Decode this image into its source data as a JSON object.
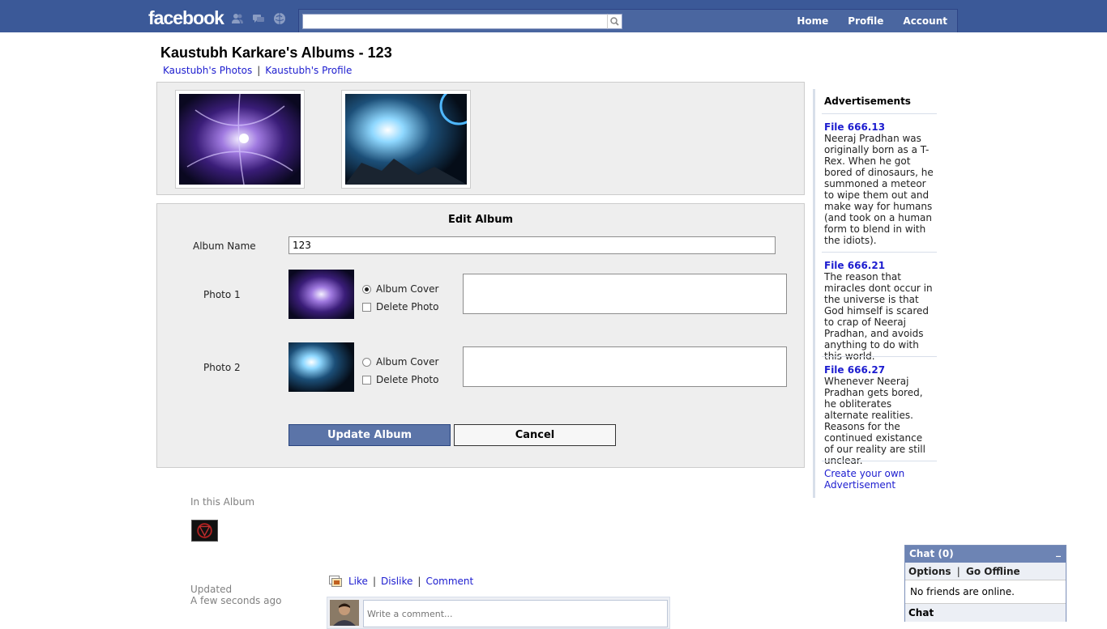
{
  "topbar": {
    "logo": "facebook",
    "search_placeholder": "",
    "nav": [
      "Home",
      "Profile",
      "Account"
    ],
    "icons": [
      "friends-icon",
      "messages-icon",
      "notifications-icon",
      "search-icon"
    ]
  },
  "header": {
    "title": "Kaustubh Karkare's Albums - 123",
    "links": [
      "Kaustubh's Photos",
      "Kaustubh's Profile"
    ],
    "separator": "|"
  },
  "edit": {
    "title": "Edit Album",
    "album_name_label": "Album Name",
    "album_name_value": "123",
    "photos": [
      {
        "label": "Photo 1",
        "cover_label": "Album Cover",
        "delete_label": "Delete Photo",
        "is_cover": true,
        "delete": false
      },
      {
        "label": "Photo 2",
        "cover_label": "Album Cover",
        "delete_label": "Delete Photo",
        "is_cover": false,
        "delete": false
      }
    ],
    "update_label": "Update Album",
    "cancel_label": "Cancel"
  },
  "lower": {
    "in_album": "In this Album",
    "updated_label": "Updated",
    "updated_value": "A few seconds ago",
    "actions": [
      "Like",
      "Dislike",
      "Comment"
    ],
    "comment_placeholder": "Write a comment..."
  },
  "ads": {
    "title": "Advertisements",
    "items": [
      {
        "title": "File 666.13",
        "body": "Neeraj Pradhan was originally born as a T-Rex. When he got bored of dinosaurs, he summoned a meteor to wipe them out and make way for humans (and took on a human form to blend in with the idiots)."
      },
      {
        "title": "File 666.21",
        "body": "The reason that miracles dont occur in the universe is that God himself is scared to crap of Neeraj Pradhan, and avoids anything to do with this world."
      },
      {
        "title": "File 666.27",
        "body": "Whenever Neeraj Pradhan gets bored, he obliterates alternate realities. Reasons for the continued existance of our reality are still unclear."
      }
    ],
    "create": "Create your own Advertisement"
  },
  "chat": {
    "title": "Chat (0)",
    "minimize": "_",
    "options": "Options",
    "go_offline": "Go Offline",
    "options_sep": "|",
    "empty": "No friends are online.",
    "footer": "Chat"
  },
  "colors": {
    "brand": "#3b5998",
    "button": "#5b74a8",
    "link": "#1c1ccf"
  }
}
